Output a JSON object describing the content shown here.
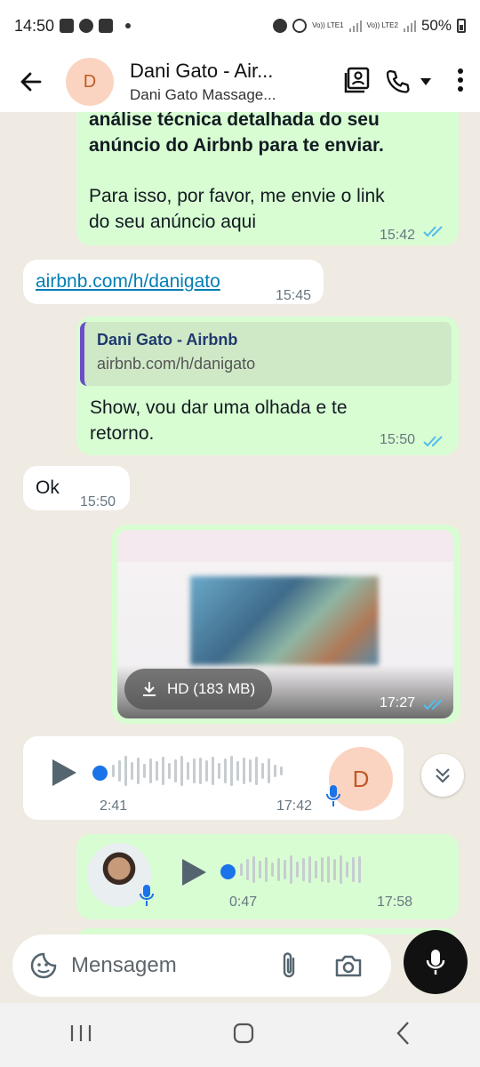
{
  "status_bar": {
    "time": "14:50",
    "network1": "Vo)) LTE1",
    "network2": "Vo)) LTE2",
    "battery": "50%"
  },
  "header": {
    "contact_name": "Dani Gato - Air...",
    "contact_subtitle": "Dani Gato Massage...",
    "avatar_initial": "D"
  },
  "messages": {
    "m1": {
      "bold_line1": "análise técnica detalhada do seu",
      "bold_line2": "anúncio do Airbnb para te enviar.",
      "line3": "Para isso, por favor, me envie o link",
      "line4": "do seu anúncio aqui",
      "time": "15:42"
    },
    "m2": {
      "link": "airbnb.com/h/danigato",
      "time": "15:45"
    },
    "m3": {
      "quote_title": "Dani Gato - Airbnb",
      "quote_sub": "airbnb.com/h/danigato",
      "line1": "Show, vou dar uma olhada e te",
      "line2": "retorno.",
      "time": "15:50"
    },
    "m4": {
      "text": "Ok",
      "time": "15:50"
    },
    "m5": {
      "download_label": "HD (183 MB)",
      "time": "17:27"
    },
    "m6": {
      "duration": "2:41",
      "time": "17:42",
      "avatar_initial": "D"
    },
    "m7": {
      "duration": "0:47",
      "time": "17:58"
    }
  },
  "composer": {
    "placeholder": "Mensagem"
  },
  "colors": {
    "outgoing": "#d9fdd3",
    "incoming": "#ffffff",
    "tick_blue": "#53bdeb",
    "chat_bg": "#efeae2"
  }
}
